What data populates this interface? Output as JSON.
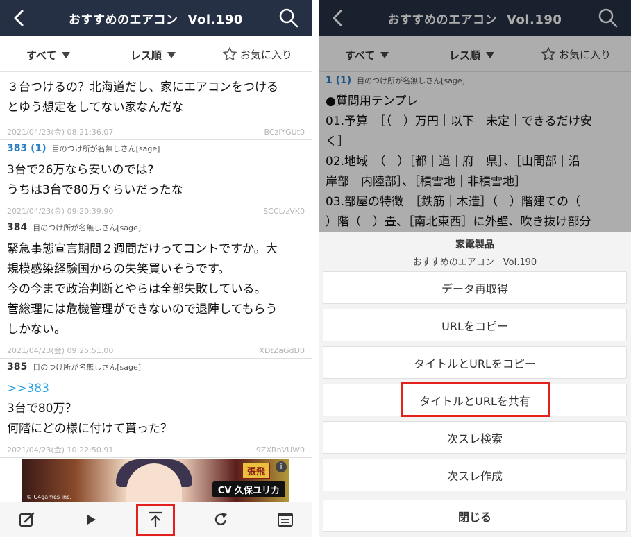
{
  "left": {
    "header": {
      "title": "おすすめのエアコン",
      "vol": "Vol.190"
    },
    "filters": {
      "all": "すべて",
      "order": "レス順",
      "favorite": "お気に入り"
    },
    "posts": [
      {
        "num": "",
        "name": "",
        "body": [
          "３台つけるの？北海道だし、家にエアコンをつける",
          "とゆう想定をしてない家なんだな"
        ],
        "date": "2021/04/23(金) 08:21:36.07",
        "id": "BCzlYGUt0"
      },
      {
        "num": "383 (1)",
        "name": "目のつけ所が名無しさん[sage]",
        "body": [
          "3台で26万なら安いのでは?",
          "うちは3台で80万ぐらいだったな"
        ],
        "date": "2021/04/23(金) 09:20:39.90",
        "id": "SCCL/zVK0"
      },
      {
        "num": "384",
        "name": "目のつけ所が名無しさん[sage]",
        "body": [
          "緊急事態宣言期間２週間だけってコントですか。大",
          "規模感染経験国からの失笑買いそうです。",
          "今の今まで政治判断とやらは全部失敗している。",
          "菅総理には危機管理ができないので退陣してもらう",
          "しかない。"
        ],
        "date": "2021/04/23(金) 09:25:51.00",
        "id": "XDtZaGdD0"
      },
      {
        "num": "385",
        "name": "目のつけ所が名無しさん[sage]",
        "anchor": ">>383",
        "body": [
          "3台で80万？",
          "何階にどの様に付けて貰った？"
        ],
        "date": "2021/04/23(金) 10:22:50.91",
        "id": "9ZXRnVUW0"
      }
    ],
    "ad": {
      "tag": "張飛",
      "cv": "CV 久保ユリカ",
      "copyright": "© C4games Inc.",
      "info": "i"
    }
  },
  "right": {
    "header": {
      "title": "おすすめのエアコン",
      "vol": "Vol.190"
    },
    "filters": {
      "all": "すべて",
      "order": "レス順",
      "favorite": "お気に入り"
    },
    "post": {
      "num": "1 (1)",
      "name": "目のつけ所が名無しさん[sage]",
      "body": [
        "●質問用テンプレ",
        "01.予算　［（　）万円｜以下｜未定｜できるだけ安",
        "く］",
        "02.地域　（　）［都｜道｜府｜県］、［山間部｜沿",
        "岸部｜内陸部］、［積雪地｜非積雪地］",
        "03.部屋の特徴　［鉄筋｜木造］（　）階建ての（",
        "）階（　）畳、［南北東西］に外壁、吹き抜け部分"
      ]
    },
    "sheet": {
      "title": "家電製品",
      "subtitle": "おすすめのエアコン　Vol.190",
      "buttons": [
        "データ再取得",
        "URLをコピー",
        "タイトルとURLをコピー",
        "タイトルとURLを共有",
        "次スレ検索",
        "次スレ作成"
      ],
      "close": "閉じる"
    }
  },
  "colors": {
    "header": "#253044",
    "accent": "#2a7ec5",
    "highlight": "#e3201b"
  }
}
